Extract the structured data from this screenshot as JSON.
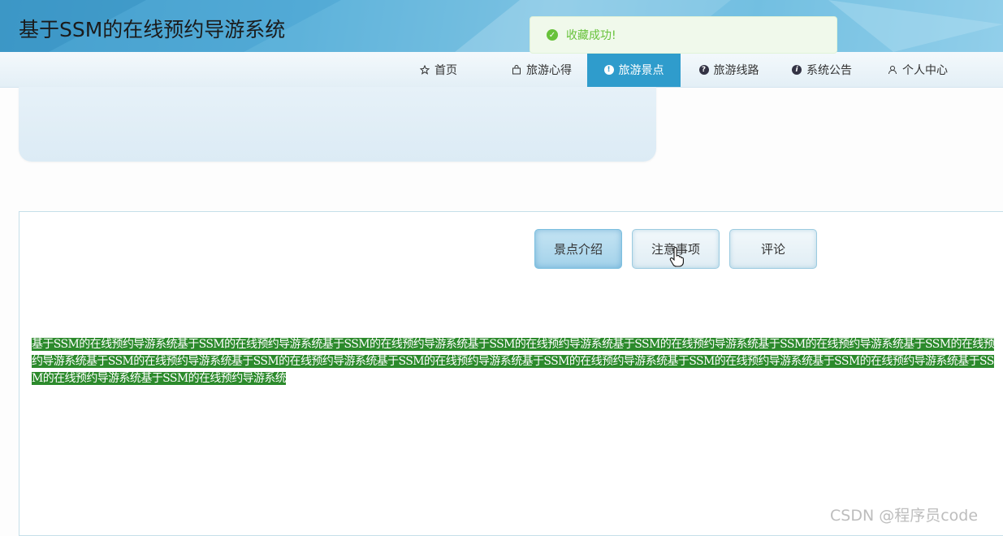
{
  "header": {
    "title": "基于SSM的在线预约导游系统"
  },
  "nav": {
    "items": [
      {
        "label": "首页",
        "icon": "star-icon"
      },
      {
        "label": "旅游心得",
        "icon": "bag-icon"
      },
      {
        "label": "旅游景点",
        "icon": "alert-circle-icon",
        "active": true
      },
      {
        "label": "旅游线路",
        "icon": "help-circle-icon"
      },
      {
        "label": "系统公告",
        "icon": "info-circle-icon"
      },
      {
        "label": "个人中心",
        "icon": "user-icon"
      }
    ]
  },
  "toast": {
    "message": "收藏成功!",
    "color": "#67c23a"
  },
  "tabs": [
    {
      "label": "景点介绍",
      "active": true
    },
    {
      "label": "注意事项"
    },
    {
      "label": "评论"
    }
  ],
  "content": {
    "text": "基于SSM的在线预约导游系统基于SSM的在线预约导游系统基于SSM的在线预约导游系统基于SSM的在线预约导游系统基于SSM的在线预约导游系统基于SSM的在线预约导游系统基于SSM的在线预约导游系统基于SSM的在线预约导游系统基于SSM的在线预约导游系统基于SSM的在线预约导游系统基于SSM的在线预约导游系统基于SSM的在线预约导游系统基于SSM的在线预约导游系统基于SSM的在线预约导游系统基于SSM的在线预约导游系统"
  },
  "watermark": "CSDN @程序员code",
  "colors": {
    "accent": "#2f9ccc",
    "selection": "#2c8a2c"
  }
}
